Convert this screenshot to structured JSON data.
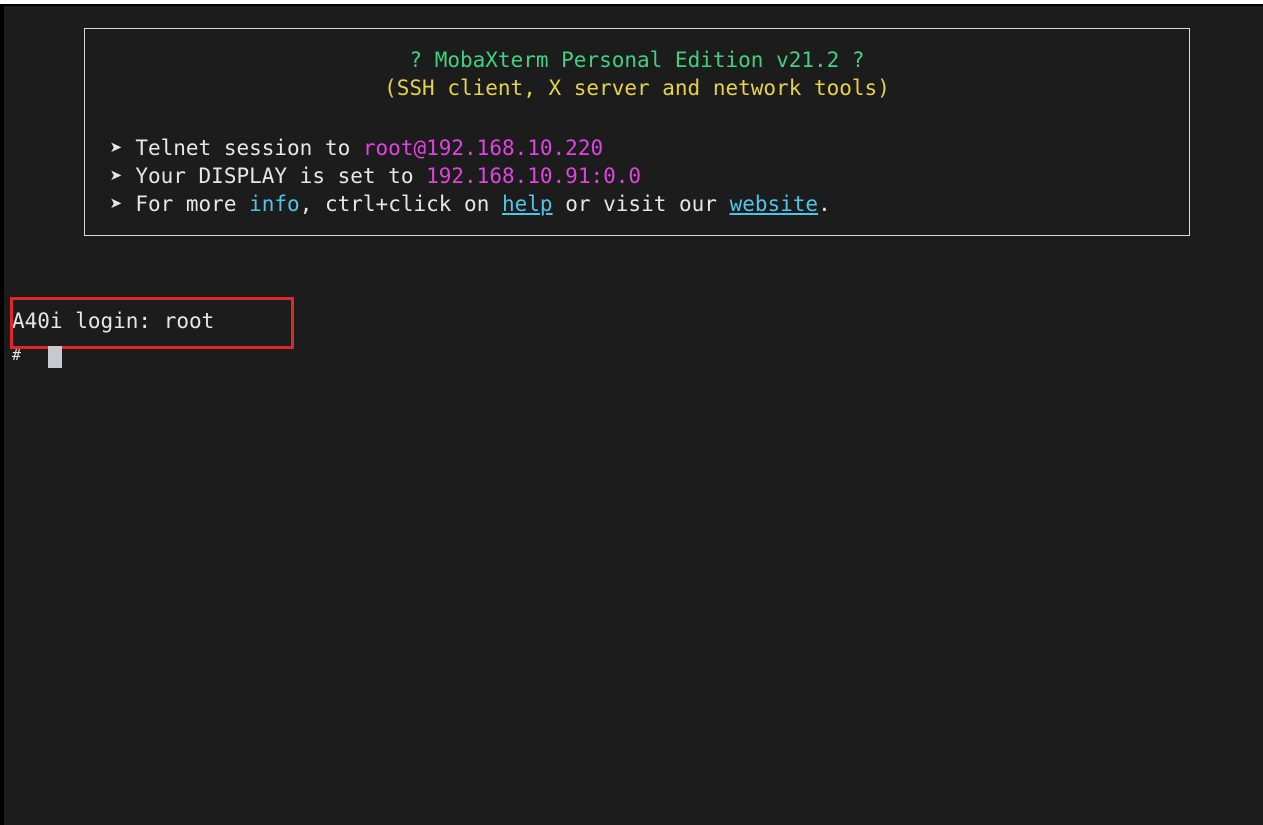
{
  "banner": {
    "title": "? MobaXterm Personal Edition v21.2 ?",
    "subtitle": "(SSH client, X server and network tools)",
    "bullet": "➤",
    "session_prefix": "Telnet session to ",
    "session_host": "root@192.168.10.220",
    "display_prefix": "Your DISPLAY is set to ",
    "display_value": "192.168.10.91:0.0",
    "info_prefix": "For more ",
    "info_link": "info",
    "info_middle": ", ctrl+click on ",
    "help_link": "help",
    "info_or": " or visit our ",
    "website_link": "website",
    "info_end": "."
  },
  "terminal": {
    "login_line": "A40i login: root",
    "prompt": "#"
  },
  "colors": {
    "background": "#1c1c1c",
    "title": "#41d17e",
    "subtitle": "#e5d14b",
    "host": "#e043e0",
    "link": "#4fc3e8",
    "highlight": "#e0282c"
  }
}
